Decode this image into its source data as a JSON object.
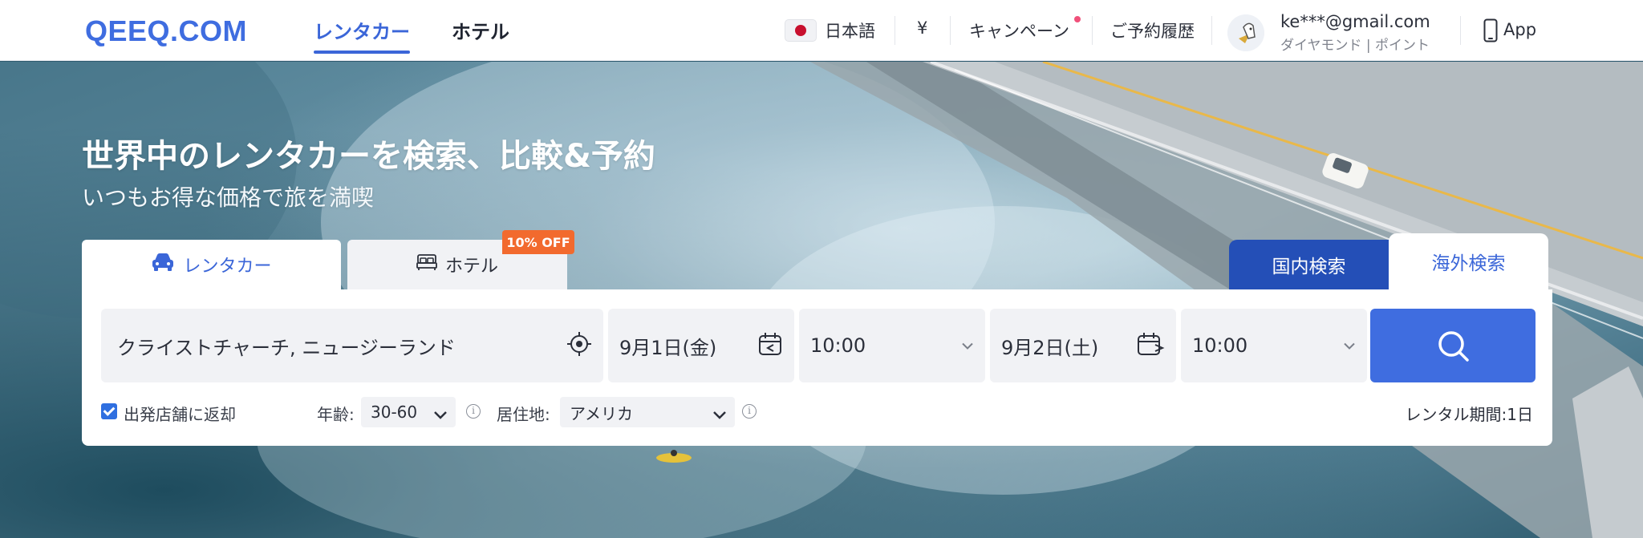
{
  "header": {
    "logo": "QEEQ.COM",
    "nav": {
      "rentacar": "レンタカー",
      "hotel": "ホテル"
    },
    "language": "日本語",
    "currency": "¥",
    "campaign": "キャンペーン",
    "bookings": "ご予約履歴",
    "user": {
      "email": "ke***@gmail.com",
      "sub": "ダイヤモンド | ポイント"
    },
    "app": "App"
  },
  "hero": {
    "title": "世界中のレンタカーを検索、比較&予約",
    "subtitle": "いつもお得な価格で旅を満喫"
  },
  "search": {
    "tabs": {
      "rentacar": "レンタカー",
      "hotel": "ホテル",
      "hotel_badge": "10% OFF"
    },
    "scope": {
      "domestic": "国内検索",
      "overseas": "海外検索"
    },
    "location": "クライストチャーチ, ニュージーランド",
    "pickup_date": "9月1日(金)",
    "pickup_time": "10:00",
    "dropoff_date": "9月2日(土)",
    "dropoff_time": "10:00",
    "return_same": {
      "label": "出発店舗に返却",
      "checked": true
    },
    "age": {
      "label": "年齢:",
      "value": "30-60"
    },
    "residence": {
      "label": "居住地:",
      "value": "アメリカ"
    },
    "period": "レンタル期間:1日"
  },
  "colors": {
    "primary": "#3f6de0",
    "domestic_tab": "#244fb7",
    "badge": "#f26a2e",
    "notification_dot": "#f0507a"
  }
}
